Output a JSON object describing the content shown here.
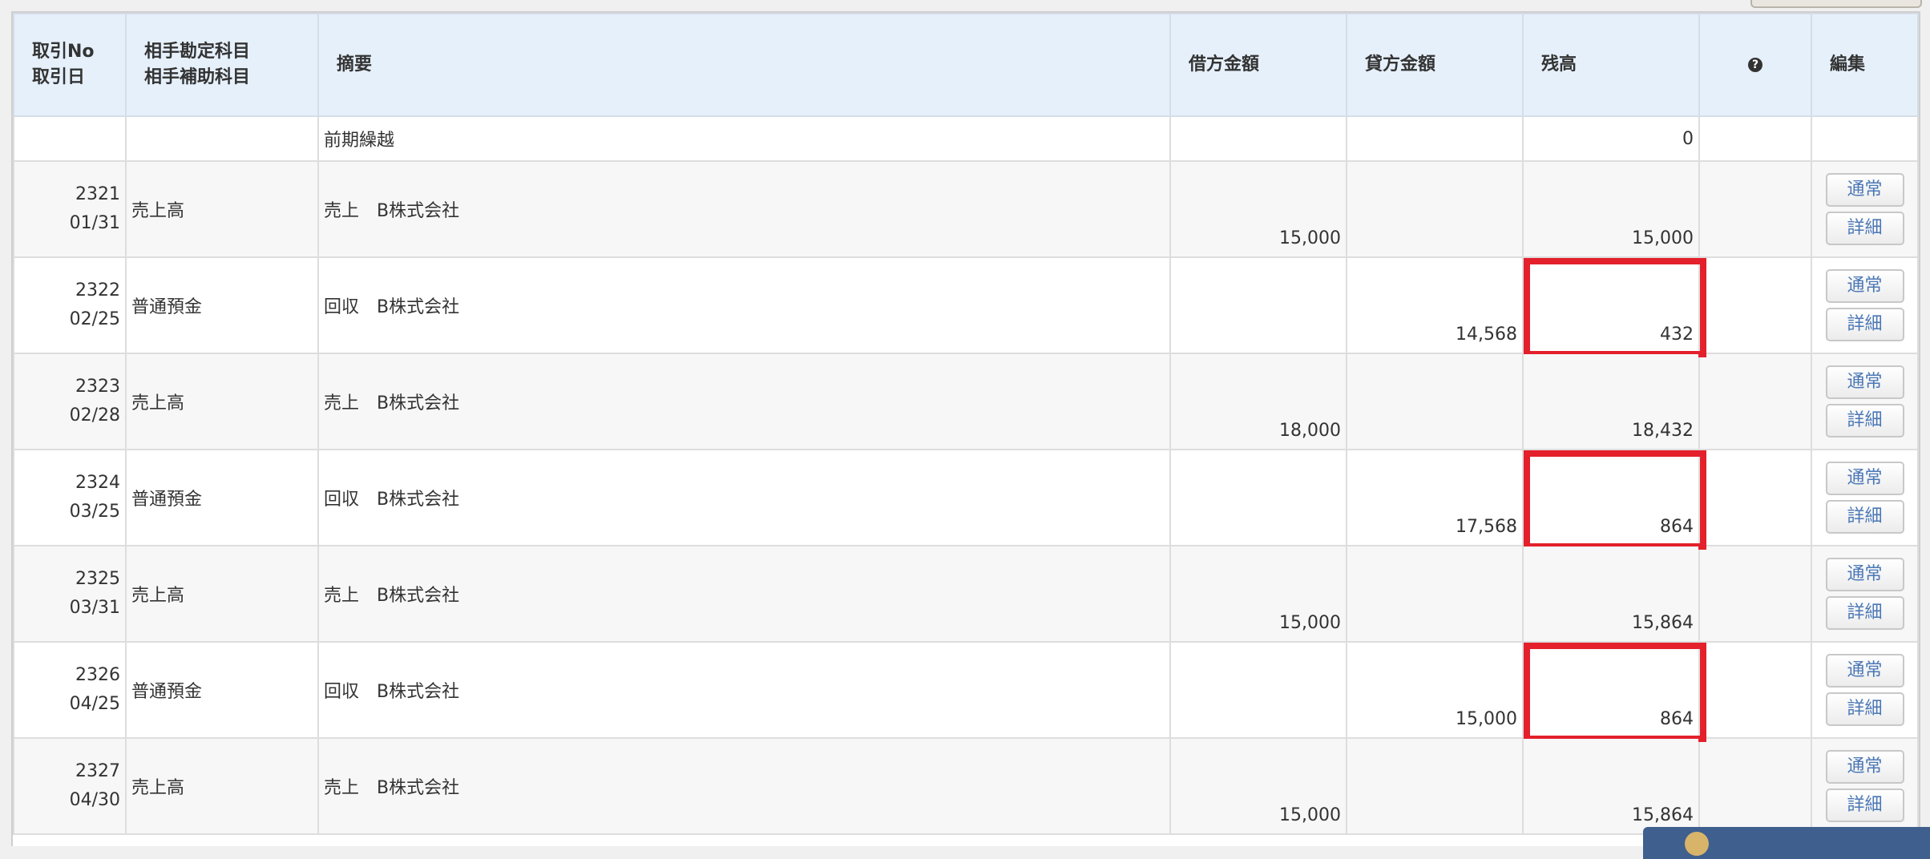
{
  "header": {
    "no_line1": "取引No",
    "no_line2": "取引日",
    "acct_line1": "相手勘定科目",
    "acct_line2": "相手補助科目",
    "description": "摘要",
    "debit": "借方金額",
    "credit": "貸方金額",
    "balance": "残高",
    "help": "?",
    "edit": "編集"
  },
  "carry_row": {
    "description": "前期繰越",
    "balance": "0"
  },
  "rows": [
    {
      "no": "2321",
      "date": "01/31",
      "account": "売上高",
      "description": "売上　B株式会社",
      "debit": "15,000",
      "credit": "",
      "balance": "15,000",
      "highlighted": false,
      "btn_normal": "通常",
      "btn_detail": "詳細"
    },
    {
      "no": "2322",
      "date": "02/25",
      "account": "普通預金",
      "description": "回収　B株式会社",
      "debit": "",
      "credit": "14,568",
      "balance": "432",
      "highlighted": true,
      "btn_normal": "通常",
      "btn_detail": "詳細"
    },
    {
      "no": "2323",
      "date": "02/28",
      "account": "売上高",
      "description": "売上　B株式会社",
      "debit": "18,000",
      "credit": "",
      "balance": "18,432",
      "highlighted": false,
      "btn_normal": "通常",
      "btn_detail": "詳細"
    },
    {
      "no": "2324",
      "date": "03/25",
      "account": "普通預金",
      "description": "回収　B株式会社",
      "debit": "",
      "credit": "17,568",
      "balance": "864",
      "highlighted": true,
      "btn_normal": "通常",
      "btn_detail": "詳細"
    },
    {
      "no": "2325",
      "date": "03/31",
      "account": "売上高",
      "description": "売上　B株式会社",
      "debit": "15,000",
      "credit": "",
      "balance": "15,864",
      "highlighted": false,
      "btn_normal": "通常",
      "btn_detail": "詳細"
    },
    {
      "no": "2326",
      "date": "04/25",
      "account": "普通預金",
      "description": "回収　B株式会社",
      "debit": "",
      "credit": "15,000",
      "balance": "864",
      "highlighted": true,
      "btn_normal": "通常",
      "btn_detail": "詳細"
    },
    {
      "no": "2327",
      "date": "04/30",
      "account": "売上高",
      "description": "売上　B株式会社",
      "debit": "15,000",
      "credit": "",
      "balance": "15,864",
      "highlighted": false,
      "btn_normal": "通常",
      "btn_detail": "詳細"
    }
  ],
  "colors": {
    "header_bg": "#e6f0fb",
    "highlight": "#e3202b",
    "button_text": "#4a77b6"
  }
}
